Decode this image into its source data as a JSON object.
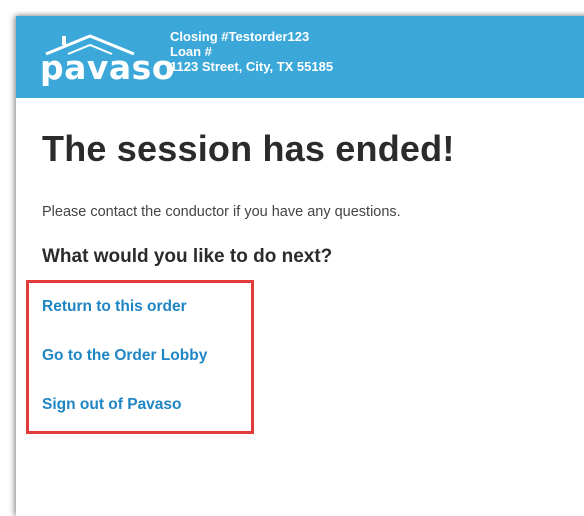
{
  "header": {
    "logo_text": "pavaso",
    "closing_line": "Closing #Testorder123",
    "loan_line": "Loan #",
    "address_line": "1123 Street, City, TX 55185"
  },
  "main": {
    "title": "The session has ended!",
    "message": "Please contact the conductor if you have any questions.",
    "next_heading": "What would you like to do next?",
    "links": [
      {
        "label": "Return to this order"
      },
      {
        "label": "Go to the Order Lobby"
      },
      {
        "label": "Sign out of Pavaso"
      }
    ]
  },
  "colors": {
    "header_bg": "#3ba8d9",
    "link": "#1f86c4",
    "highlight_border": "#e23b3b"
  }
}
